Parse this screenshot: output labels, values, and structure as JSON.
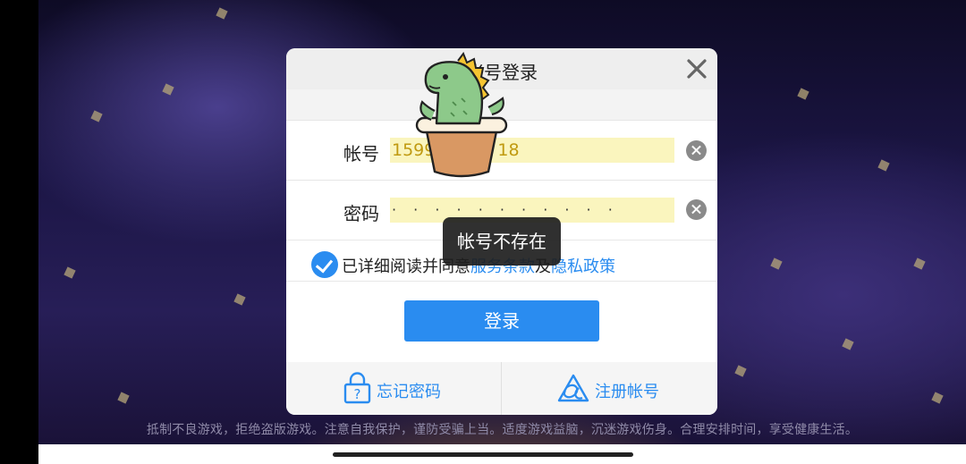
{
  "dialog": {
    "title": "帐号登录",
    "account_label": "帐号",
    "account_value": "1599",
    "account_value_tail": "18",
    "password_label": "密码",
    "password_value": "· · · · · · · · · · ·",
    "agree_prefix": "已详细阅读并同意",
    "terms_link": "服务条款",
    "agree_and": "及",
    "privacy_link": "隐私政策",
    "login_button": "登录",
    "forgot_password": "忘记密码",
    "register": "注册帐号"
  },
  "toast": {
    "message": "帐号不存在"
  },
  "notice": "抵制不良游戏，拒绝盗版游戏。注意自我保护，谨防受骗上当。适度游戏益脑，沉迷游戏伤身。合理安排时间，享受健康生活。",
  "icons": [
    "close-icon",
    "clear-icon",
    "checkbox-checked-icon",
    "question-lock-icon",
    "triangle-logo-icon",
    "cactus-dinosaur-sticker"
  ],
  "colors": {
    "accent": "#2a8cf0",
    "input_bg": "#faf5be",
    "toast_bg": "#1e1e1e"
  }
}
